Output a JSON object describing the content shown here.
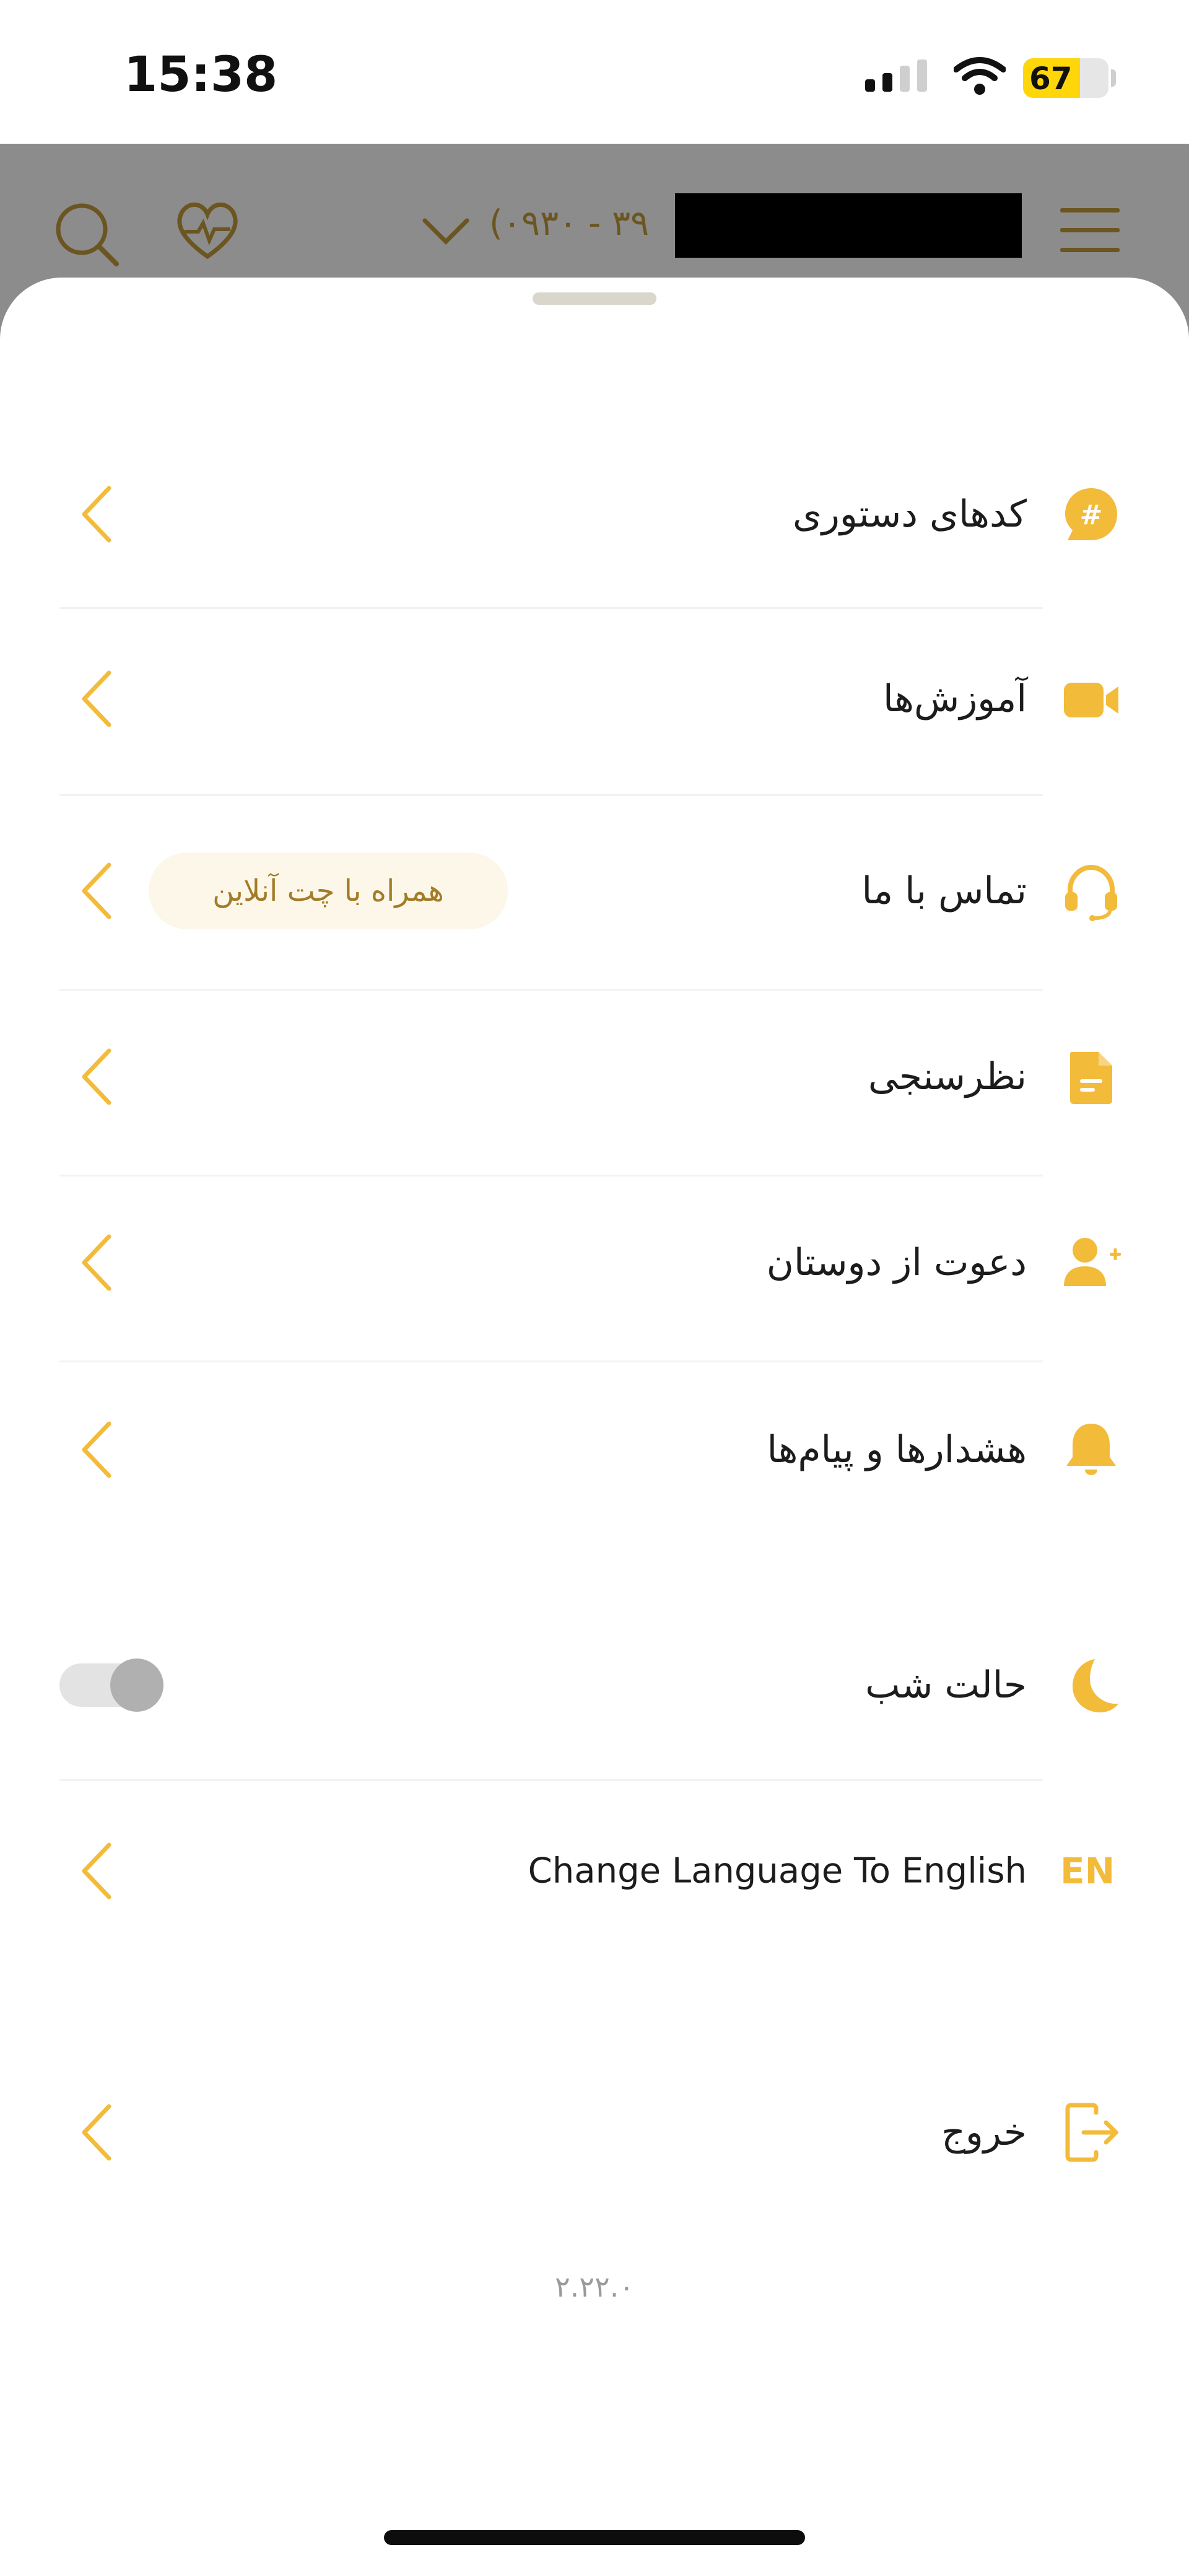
{
  "status_bar": {
    "time": "15:38",
    "battery_level": "67",
    "battery_fraction": 0.67
  },
  "header": {
    "phone_partial": "(۰۹۳۰ - ۳۹"
  },
  "menu": [
    {
      "label": "کدهای دستوری",
      "icon": "hash-chat-icon"
    },
    {
      "label": "آموزش‌ها",
      "icon": "video-camera-icon"
    },
    {
      "label": "تماس با ما",
      "icon": "headset-icon",
      "chip": "همراه با چت آنلاین"
    },
    {
      "label": "نظرسنجی",
      "icon": "document-icon"
    },
    {
      "label": "دعوت از دوستان",
      "icon": "add-user-icon"
    },
    {
      "label": "هشدارها و پیام‌ها",
      "icon": "bell-icon"
    }
  ],
  "night_mode": {
    "label": "حالت شب",
    "enabled": false
  },
  "language": {
    "label": "Change Language To English",
    "icon_text": "EN"
  },
  "logout": {
    "label": "خروج"
  },
  "version": "۲.۲۲.۰",
  "colors": {
    "accent": "#f3bb3a",
    "chip_bg": "#fdf7ea",
    "chip_text": "#a27c27"
  }
}
